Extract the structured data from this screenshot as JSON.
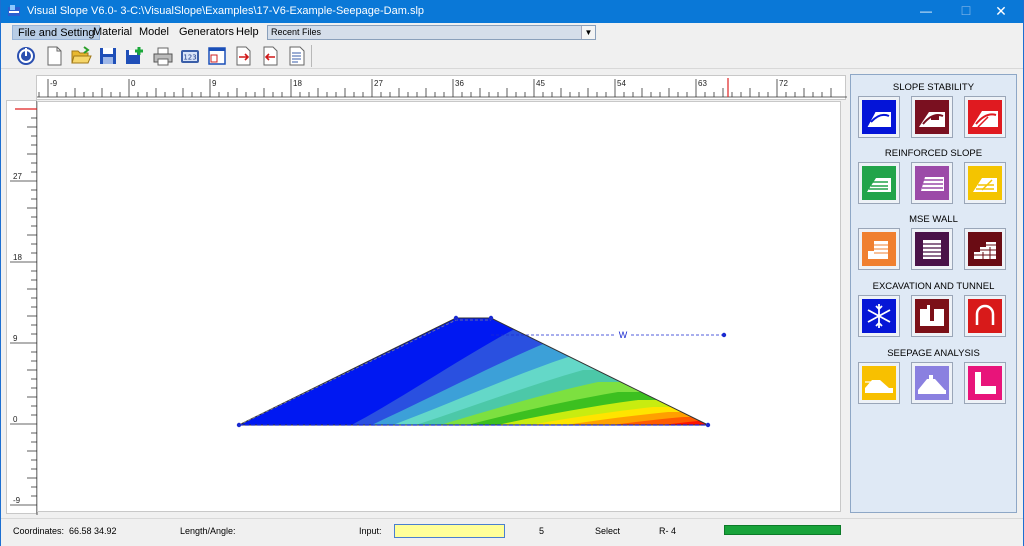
{
  "window": {
    "title": "Visual Slope V6.0- 3-C:\\VisualSlope\\Examples\\17-V6-Example-Seepage-Dam.slp",
    "minimize": "—",
    "maximize": "☐",
    "close": "✕"
  },
  "menu": {
    "items": [
      "File and Setting",
      "Material",
      "Model",
      "Generators",
      "Help"
    ],
    "recent_files": "Recent Files"
  },
  "toolbar": {
    "buttons": [
      "power-icon",
      "new-file-icon",
      "open-folder-icon",
      "save-icon",
      "save-as-icon",
      "print-icon",
      "calculator-icon",
      "window-icon",
      "export-icon",
      "import-icon",
      "report-icon"
    ]
  },
  "rulers": {
    "horizontal_labels": [
      "-9",
      "0",
      "9",
      "18",
      "27",
      "36",
      "45",
      "54",
      "63",
      "72"
    ],
    "vertical_labels": [
      "27",
      "18",
      "9",
      "0",
      "-9"
    ]
  },
  "model": {
    "water_label": "W",
    "colors": {
      "blue": "#0018f2",
      "red": "#ff1200"
    }
  },
  "panel": {
    "sections": [
      {
        "title": "SLOPE STABILITY",
        "tiles": [
          {
            "name": "slope-stability-1",
            "color": "#0414d8"
          },
          {
            "name": "slope-stability-2",
            "color": "#7a1020"
          },
          {
            "name": "slope-stability-3",
            "color": "#e01a20"
          }
        ]
      },
      {
        "title": "REINFORCED SLOPE",
        "tiles": [
          {
            "name": "reinforced-slope-1",
            "color": "#22a44a"
          },
          {
            "name": "reinforced-slope-2",
            "color": "#9c4aa8"
          },
          {
            "name": "reinforced-slope-3",
            "color": "#f4c400"
          }
        ]
      },
      {
        "title": "MSE WALL",
        "tiles": [
          {
            "name": "mse-wall-1",
            "color": "#f08030"
          },
          {
            "name": "mse-wall-2",
            "color": "#4a1248"
          },
          {
            "name": "mse-wall-3",
            "color": "#6a0c14"
          }
        ]
      },
      {
        "title": "EXCAVATION AND TUNNEL",
        "tiles": [
          {
            "name": "excavation-1",
            "color": "#0616d6"
          },
          {
            "name": "excavation-2",
            "color": "#7c1018"
          },
          {
            "name": "excavation-3",
            "color": "#d81a1a"
          }
        ]
      },
      {
        "title": "SEEPAGE ANALYSIS",
        "tiles": [
          {
            "name": "seepage-1",
            "color": "#f8c000"
          },
          {
            "name": "seepage-2",
            "color": "#8a80e0"
          },
          {
            "name": "seepage-3",
            "color": "#e8147a"
          }
        ]
      }
    ]
  },
  "status": {
    "coordinates_label": "Coordinates:",
    "coordinates_value": "66.58  34.92",
    "length_label": "Length/Angle:",
    "input_label": "Input:",
    "count": "5",
    "mode": "Select",
    "r_value": "R- 4"
  }
}
